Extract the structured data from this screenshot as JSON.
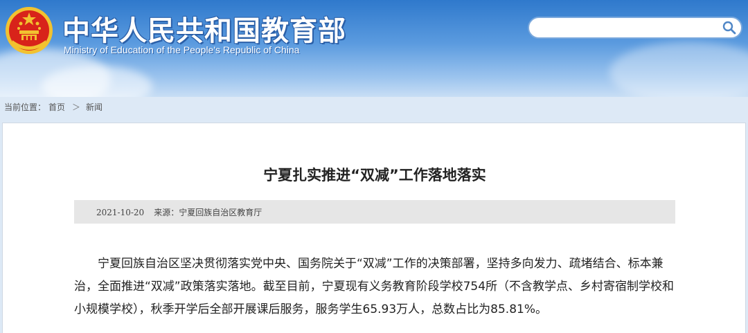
{
  "header": {
    "title": "中华人民共和国教育部",
    "subtitle": "Ministry of Education of the People's Republic of China",
    "emblem_icon": "national-emblem-icon",
    "search": {
      "value": "",
      "placeholder": "",
      "icon": "search-icon"
    }
  },
  "breadcrumb": {
    "prefix": "当前位置：",
    "items": [
      "首页",
      "新闻"
    ],
    "separator": "＞"
  },
  "article": {
    "title": "宁夏扎实推进“双减”工作落地落实",
    "date": "2021-10-20",
    "source_label": "来源：",
    "source": "宁夏回族自治区教育厅",
    "body": "宁夏回族自治区坚决贯彻落实党中央、国务院关于“双减”工作的决策部署，坚持多向发力、疏堵结合、标本兼治，全面推进“双减”政策落实落地。截至目前，宁夏现有义务教育阶段学校754所（不含教学点、乡村寄宿制学校和小规模学校），秋季开学后全部开展课后服务，服务学生65.93万人，总数占比为85.81%。"
  },
  "colors": {
    "header_blue": "#2f79cc",
    "emblem_red": "#d8231a",
    "emblem_gold": "#f2c230",
    "meta_bar_bg": "#e6e6e6"
  }
}
